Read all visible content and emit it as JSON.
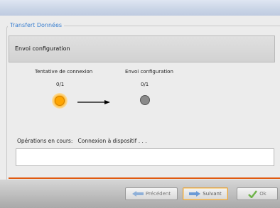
{
  "dialog": {
    "group_title": "Transfert Données",
    "step_header": "Envoi configuration"
  },
  "stages": [
    {
      "label": "Tentative de connexion",
      "count": "0/1",
      "state": "active"
    },
    {
      "label": "Envoi configuration",
      "count": "0/1",
      "state": "pending"
    }
  ],
  "operations": {
    "label": "Opérations en cours:",
    "value": "Connexion à dispositif . . .",
    "log_text": ""
  },
  "buttons": {
    "previous": "Précédent",
    "next": "Suivant",
    "ok": "Ok"
  },
  "colors": {
    "accent": "#e05a10",
    "legend": "#3a7fd0",
    "active_stage": "#ffa500",
    "idle_stage": "#8a8a8a"
  }
}
